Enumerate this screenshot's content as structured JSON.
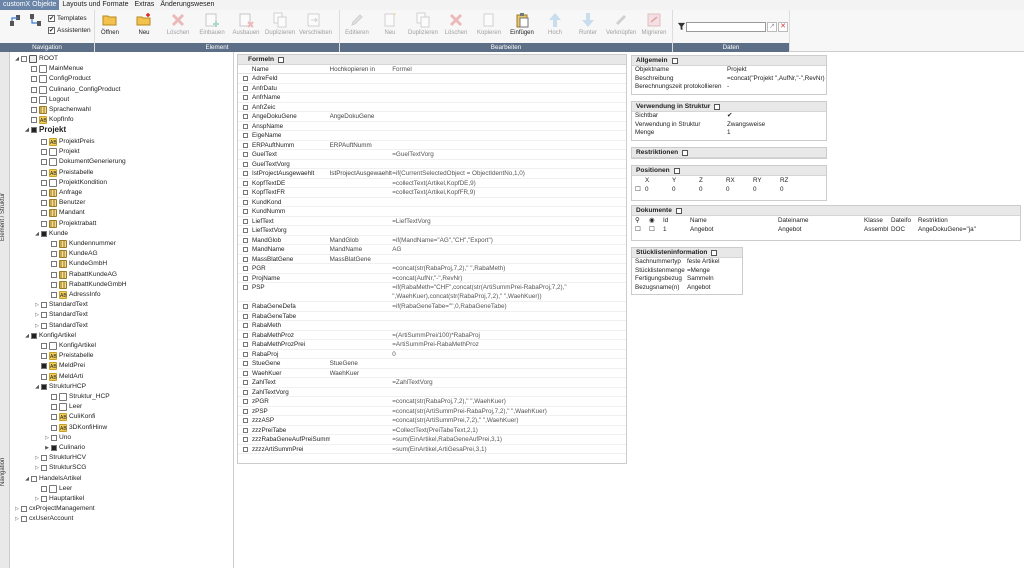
{
  "menubar": {
    "items": [
      "customX Objekte",
      "Layouts und Formate",
      "Extras",
      "Änderungswesen"
    ],
    "active_index": 0
  },
  "ribbon": {
    "groups": {
      "navigation": "Navigation",
      "element": "Element",
      "bearbeiten": "Bearbeiten",
      "daten": "Daten"
    },
    "checkboxes": {
      "templates": "Templates",
      "assistenten": "Assistenten"
    },
    "element_buttons": [
      {
        "label": "Öffnen",
        "icon": "folder-open-icon",
        "enabled": true
      },
      {
        "label": "Neu",
        "icon": "new-folder-icon",
        "enabled": true
      },
      {
        "label": "Löschen",
        "icon": "delete-icon",
        "enabled": false
      },
      {
        "label": "Einbauen",
        "icon": "insert-icon",
        "enabled": false
      },
      {
        "label": "Ausbauen",
        "icon": "remove-icon",
        "enabled": false
      },
      {
        "label": "Duplizieren",
        "icon": "duplicate-icon",
        "enabled": false
      },
      {
        "label": "Verschieben",
        "icon": "move-icon",
        "enabled": false
      }
    ],
    "edit_buttons": [
      {
        "label": "Editieren",
        "icon": "edit-icon",
        "enabled": false
      },
      {
        "label": "Neu",
        "icon": "new-icon",
        "enabled": false
      },
      {
        "label": "Duplizieren",
        "icon": "duplicate-icon",
        "enabled": false
      },
      {
        "label": "Löschen",
        "icon": "delete-icon",
        "enabled": false
      },
      {
        "label": "Kopieren",
        "icon": "copy-icon",
        "enabled": false
      },
      {
        "label": "Einfügen",
        "icon": "paste-icon",
        "enabled": true
      },
      {
        "label": "Hoch",
        "icon": "arrow-up-icon",
        "enabled": false
      },
      {
        "label": "Runter",
        "icon": "arrow-down-icon",
        "enabled": false
      },
      {
        "label": "Verknüpfen",
        "icon": "link-icon",
        "enabled": false
      },
      {
        "label": "Migrieren",
        "icon": "migrate-icon",
        "enabled": false
      }
    ],
    "search_value": ""
  },
  "vtabs": {
    "element_struktur": "Element / Struktur",
    "navigation": "Navigation"
  },
  "tree": [
    {
      "label": "ROOT",
      "depth": 0,
      "exp": "▲",
      "icon": "db",
      "cb": false
    },
    {
      "label": "MainMenue",
      "depth": 1,
      "exp": "",
      "icon": "doc",
      "cb": false
    },
    {
      "label": "ConfigProduct",
      "depth": 1,
      "exp": "",
      "icon": "doc",
      "cb": false
    },
    {
      "label": "Culinario_ConfigProduct",
      "depth": 1,
      "exp": "",
      "icon": "doc",
      "cb": false
    },
    {
      "label": "Logout",
      "depth": 1,
      "exp": "",
      "icon": "doc",
      "cb": false
    },
    {
      "label": "Sprachenwahl",
      "depth": 1,
      "exp": "",
      "icon": "grid",
      "cb": false
    },
    {
      "label": "KopfInfo",
      "depth": 1,
      "exp": "",
      "icon": "ab",
      "cb": false
    },
    {
      "label": "Projekt",
      "depth": 1,
      "exp": "▲",
      "icon": "",
      "cb": true,
      "bold": true
    },
    {
      "label": "ProjektPreis",
      "depth": 2,
      "exp": "",
      "icon": "ab",
      "cb": false
    },
    {
      "label": "Projekt",
      "depth": 2,
      "exp": "",
      "icon": "doc",
      "cb": false
    },
    {
      "label": "DokumentGenerierung",
      "depth": 2,
      "exp": "",
      "icon": "doc",
      "cb": false
    },
    {
      "label": "Preistabelle",
      "depth": 2,
      "exp": "",
      "icon": "ab",
      "cb": false
    },
    {
      "label": "ProjektKondition",
      "depth": 2,
      "exp": "",
      "icon": "doc",
      "cb": false
    },
    {
      "label": "Anfrage",
      "depth": 2,
      "exp": "",
      "icon": "grid",
      "cb": false
    },
    {
      "label": "Benutzer",
      "depth": 2,
      "exp": "",
      "icon": "grid",
      "cb": false
    },
    {
      "label": "Mandant",
      "depth": 2,
      "exp": "",
      "icon": "grid",
      "cb": false
    },
    {
      "label": "Projektrabatt",
      "depth": 2,
      "exp": "",
      "icon": "grid",
      "cb": false
    },
    {
      "label": "Kunde",
      "depth": 2,
      "exp": "▲",
      "icon": "",
      "cb": true
    },
    {
      "label": "Kundennummer",
      "depth": 3,
      "exp": "",
      "icon": "grid",
      "cb": false
    },
    {
      "label": "KundeAG",
      "depth": 3,
      "exp": "",
      "icon": "grid",
      "cb": false
    },
    {
      "label": "KundeGmbH",
      "depth": 3,
      "exp": "",
      "icon": "grid",
      "cb": false
    },
    {
      "label": "RabattKundeAG",
      "depth": 3,
      "exp": "",
      "icon": "grid",
      "cb": false
    },
    {
      "label": "RabattKundeGmbH",
      "depth": 3,
      "exp": "",
      "icon": "grid",
      "cb": false
    },
    {
      "label": "AdressInfo",
      "depth": 3,
      "exp": "",
      "icon": "ab",
      "cb": false
    },
    {
      "label": "StandardText",
      "depth": 2,
      "exp": "▷",
      "icon": "",
      "cb": false
    },
    {
      "label": "StandardText",
      "depth": 2,
      "exp": "▷",
      "icon": "",
      "cb": false
    },
    {
      "label": "StandardText",
      "depth": 2,
      "exp": "▷",
      "icon": "",
      "cb": false
    },
    {
      "label": "KonfigArtikel",
      "depth": 1,
      "exp": "▲",
      "icon": "",
      "cb": true
    },
    {
      "label": "KonfigArtikel",
      "depth": 2,
      "exp": "",
      "icon": "doc",
      "cb": false
    },
    {
      "label": "Preistabelle",
      "depth": 2,
      "exp": "",
      "icon": "ab",
      "cb": false
    },
    {
      "label": "MeldPrei",
      "depth": 2,
      "exp": "",
      "icon": "ab",
      "cb": true
    },
    {
      "label": "MeldArti",
      "depth": 2,
      "exp": "",
      "icon": "ab",
      "cb": false
    },
    {
      "label": "StrukturHCP",
      "depth": 2,
      "exp": "▲",
      "icon": "",
      "cb": true
    },
    {
      "label": "Struktur_HCP",
      "depth": 3,
      "exp": "",
      "icon": "doc",
      "cb": false
    },
    {
      "label": "Leer",
      "depth": 3,
      "exp": "",
      "icon": "doc",
      "cb": false
    },
    {
      "label": "CuliKonfi",
      "depth": 3,
      "exp": "",
      "icon": "ab",
      "cb": false
    },
    {
      "label": "3DKonfiHinw",
      "depth": 3,
      "exp": "",
      "icon": "ab",
      "cb": false
    },
    {
      "label": "Uno",
      "depth": 3,
      "exp": "▷",
      "icon": "",
      "cb": false
    },
    {
      "label": "Culinario",
      "depth": 3,
      "exp": "▶",
      "icon": "",
      "cb": true
    },
    {
      "label": "StrukturHCV",
      "depth": 2,
      "exp": "▷",
      "icon": "",
      "cb": false
    },
    {
      "label": "StrukturSCG",
      "depth": 2,
      "exp": "▷",
      "icon": "",
      "cb": false
    },
    {
      "label": "HandelsArtikel",
      "depth": 1,
      "exp": "▲",
      "icon": "",
      "cb": false
    },
    {
      "label": "Leer",
      "depth": 2,
      "exp": "",
      "icon": "doc",
      "cb": false
    },
    {
      "label": "Hauptartikel",
      "depth": 2,
      "exp": "▷",
      "icon": "",
      "cb": false
    },
    {
      "label": "cxProjectManagement",
      "depth": 0,
      "exp": "▷",
      "icon": "",
      "cb": false
    },
    {
      "label": "cxUserAccount",
      "depth": 0,
      "exp": "▷",
      "icon": "",
      "cb": false
    }
  ],
  "formeln": {
    "title": "Formeln",
    "columns": [
      "Name",
      "Hochkopieren in",
      "Formel"
    ],
    "rows": [
      [
        "AdreFeld",
        "",
        ""
      ],
      [
        "AnfrDatu",
        "",
        ""
      ],
      [
        "AnfrName",
        "",
        ""
      ],
      [
        "AnfrZeic",
        "",
        ""
      ],
      [
        "AngeDokuGene",
        "AngeDokuGene",
        ""
      ],
      [
        "AnspName",
        "",
        ""
      ],
      [
        "EigeName",
        "",
        ""
      ],
      [
        "ERPAuftNumm",
        "ERPAuftNumm",
        ""
      ],
      [
        "GuelText",
        "",
        "=GuelTextVorg"
      ],
      [
        "GuelTextVorg",
        "",
        ""
      ],
      [
        "IstProjectAusgewaehlt",
        "IstProjectAusgewaehlt",
        "=if(CurrentSelectedObject = ObjectIdentNo,1,0)"
      ],
      [
        "KopfTextDE",
        "",
        "=collectText(Artikel,KopfDE,9)"
      ],
      [
        "KopfTextFR",
        "",
        "=collectText(Artikel,KopfFR,9)"
      ],
      [
        "KundKond",
        "",
        ""
      ],
      [
        "KundNumm",
        "",
        ""
      ],
      [
        "LiefText",
        "",
        "=LiefTextVorg"
      ],
      [
        "LiefTextVorg",
        "",
        ""
      ],
      [
        "MandGlob",
        "MandGlob",
        "=if(MandName=\"AG\",\"CH\",\"Export\")"
      ],
      [
        "MandName",
        "MandName",
        "AG"
      ],
      [
        "MassBlatGene",
        "MassBlatGene",
        ""
      ],
      [
        "PGR",
        "",
        "=concat(str(RabaProj,7,2),\" \",RabaMeth)"
      ],
      [
        "ProjName",
        "",
        "=concat(AufNr,\"-\",RevNr)"
      ],
      [
        "PSP",
        "",
        "=if(RabaMeth=\"CHF\",concat(str(ArtiSummPrei-RabaProj,7,2),\" \",WaehKuer),concat(str(RabaProj,7,2),\" \",WaehKuer))"
      ],
      [
        "RabaGeneDefa",
        "",
        "=if(RabaGeneTabe=\"\",0,RabaGeneTabe)"
      ],
      [
        "RabaGeneTabe",
        "",
        ""
      ],
      [
        "RabaMeth",
        "",
        ""
      ],
      [
        "RabaMethProz",
        "",
        "=(ArtiSummPrei/100)*RabaProj"
      ],
      [
        "RabaMethProzPrei",
        "",
        "=ArtiSummPrei-RabaMethProz"
      ],
      [
        "RabaProj",
        "",
        "0"
      ],
      [
        "StueGene",
        "StueGene",
        ""
      ],
      [
        "WaehKuer",
        "WaehKuer",
        ""
      ],
      [
        "ZahlText",
        "",
        "=ZahlTextVorg"
      ],
      [
        "ZahlTextVorg",
        "",
        ""
      ],
      [
        "zPGR",
        "",
        "=concat(str(RabaProj,7,2),\" \",WaehKuer)"
      ],
      [
        "zPSP",
        "",
        "=concat(str(ArtiSummPrei-RabaProj,7,2),\" \",WaehKuer)"
      ],
      [
        "zzzASP",
        "",
        "=concat(str(ArtiSummPrei,7,2),\" \",WaehKuer)"
      ],
      [
        "zzzPreiTabe",
        "",
        "=CollectText(PreiTabeText,2,1)"
      ],
      [
        "zzzRabaGeneAufPreiSumm",
        "",
        "=sum(EinArtikel,RabaGeneAufPrei,3,1)"
      ],
      [
        "zzzzArtiSummPrei",
        "",
        "=sum(EinArtikel,ArtiGesaPrei,3,1)"
      ]
    ]
  },
  "allgemein": {
    "title": "Allgemein",
    "rows": [
      [
        "Objektname",
        "Projekt"
      ],
      [
        "Beschreibung",
        "=concat(\"Projekt \",AufNr,\"-\",RevNr)"
      ],
      [
        "Berechnungszeit protokollieren",
        "-"
      ]
    ]
  },
  "verwendung": {
    "title": "Verwendung in Struktur",
    "rows": [
      [
        "Sichtbar",
        "✔"
      ],
      [
        "Verwendung in Struktur",
        "Zwangsweise"
      ],
      [
        "Menge",
        "1"
      ]
    ]
  },
  "restriktionen": {
    "title": "Restriktionen"
  },
  "positionen": {
    "title": "Positionen",
    "headers": [
      "X",
      "Y",
      "Z",
      "RX",
      "RY",
      "RZ"
    ],
    "values": [
      "0",
      "0",
      "0",
      "0",
      "0",
      "0"
    ]
  },
  "dokumente": {
    "title": "Dokumente",
    "headers": [
      "Id",
      "Name",
      "Dateiname",
      "Klasse",
      "Dateifo",
      "Restriktion"
    ],
    "row": [
      "1",
      "Angebot",
      "Angebot",
      "Assembl",
      "DOC",
      "AngeDokuGene=\"ja\""
    ]
  },
  "stueckliste": {
    "title": "Stücklisteninformation",
    "rows": [
      [
        "Sachnummertyp",
        "feste Artikel"
      ],
      [
        "Stücklistenmenge",
        "=Menge"
      ],
      [
        "Fertigungsbezug",
        "Sammeln"
      ],
      [
        "Bezugsname(n)",
        "Angebot"
      ]
    ]
  }
}
